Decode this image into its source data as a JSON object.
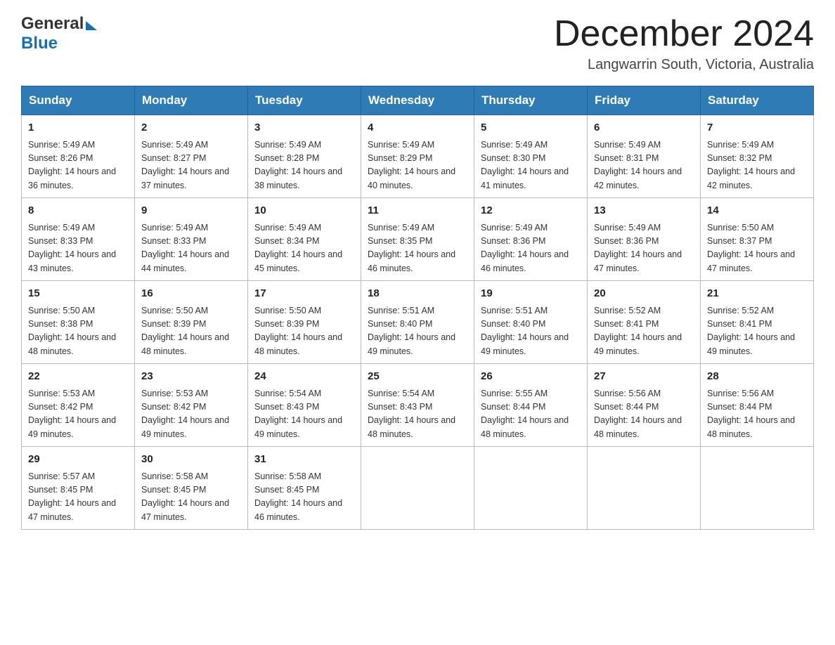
{
  "header": {
    "logo_general": "General",
    "logo_blue": "Blue",
    "month_title": "December 2024",
    "location": "Langwarrin South, Victoria, Australia"
  },
  "calendar": {
    "days_of_week": [
      "Sunday",
      "Monday",
      "Tuesday",
      "Wednesday",
      "Thursday",
      "Friday",
      "Saturday"
    ],
    "weeks": [
      [
        {
          "day": "1",
          "sunrise": "5:49 AM",
          "sunset": "8:26 PM",
          "daylight": "14 hours and 36 minutes."
        },
        {
          "day": "2",
          "sunrise": "5:49 AM",
          "sunset": "8:27 PM",
          "daylight": "14 hours and 37 minutes."
        },
        {
          "day": "3",
          "sunrise": "5:49 AM",
          "sunset": "8:28 PM",
          "daylight": "14 hours and 38 minutes."
        },
        {
          "day": "4",
          "sunrise": "5:49 AM",
          "sunset": "8:29 PM",
          "daylight": "14 hours and 40 minutes."
        },
        {
          "day": "5",
          "sunrise": "5:49 AM",
          "sunset": "8:30 PM",
          "daylight": "14 hours and 41 minutes."
        },
        {
          "day": "6",
          "sunrise": "5:49 AM",
          "sunset": "8:31 PM",
          "daylight": "14 hours and 42 minutes."
        },
        {
          "day": "7",
          "sunrise": "5:49 AM",
          "sunset": "8:32 PM",
          "daylight": "14 hours and 42 minutes."
        }
      ],
      [
        {
          "day": "8",
          "sunrise": "5:49 AM",
          "sunset": "8:33 PM",
          "daylight": "14 hours and 43 minutes."
        },
        {
          "day": "9",
          "sunrise": "5:49 AM",
          "sunset": "8:33 PM",
          "daylight": "14 hours and 44 minutes."
        },
        {
          "day": "10",
          "sunrise": "5:49 AM",
          "sunset": "8:34 PM",
          "daylight": "14 hours and 45 minutes."
        },
        {
          "day": "11",
          "sunrise": "5:49 AM",
          "sunset": "8:35 PM",
          "daylight": "14 hours and 46 minutes."
        },
        {
          "day": "12",
          "sunrise": "5:49 AM",
          "sunset": "8:36 PM",
          "daylight": "14 hours and 46 minutes."
        },
        {
          "day": "13",
          "sunrise": "5:49 AM",
          "sunset": "8:36 PM",
          "daylight": "14 hours and 47 minutes."
        },
        {
          "day": "14",
          "sunrise": "5:50 AM",
          "sunset": "8:37 PM",
          "daylight": "14 hours and 47 minutes."
        }
      ],
      [
        {
          "day": "15",
          "sunrise": "5:50 AM",
          "sunset": "8:38 PM",
          "daylight": "14 hours and 48 minutes."
        },
        {
          "day": "16",
          "sunrise": "5:50 AM",
          "sunset": "8:39 PM",
          "daylight": "14 hours and 48 minutes."
        },
        {
          "day": "17",
          "sunrise": "5:50 AM",
          "sunset": "8:39 PM",
          "daylight": "14 hours and 48 minutes."
        },
        {
          "day": "18",
          "sunrise": "5:51 AM",
          "sunset": "8:40 PM",
          "daylight": "14 hours and 49 minutes."
        },
        {
          "day": "19",
          "sunrise": "5:51 AM",
          "sunset": "8:40 PM",
          "daylight": "14 hours and 49 minutes."
        },
        {
          "day": "20",
          "sunrise": "5:52 AM",
          "sunset": "8:41 PM",
          "daylight": "14 hours and 49 minutes."
        },
        {
          "day": "21",
          "sunrise": "5:52 AM",
          "sunset": "8:41 PM",
          "daylight": "14 hours and 49 minutes."
        }
      ],
      [
        {
          "day": "22",
          "sunrise": "5:53 AM",
          "sunset": "8:42 PM",
          "daylight": "14 hours and 49 minutes."
        },
        {
          "day": "23",
          "sunrise": "5:53 AM",
          "sunset": "8:42 PM",
          "daylight": "14 hours and 49 minutes."
        },
        {
          "day": "24",
          "sunrise": "5:54 AM",
          "sunset": "8:43 PM",
          "daylight": "14 hours and 49 minutes."
        },
        {
          "day": "25",
          "sunrise": "5:54 AM",
          "sunset": "8:43 PM",
          "daylight": "14 hours and 48 minutes."
        },
        {
          "day": "26",
          "sunrise": "5:55 AM",
          "sunset": "8:44 PM",
          "daylight": "14 hours and 48 minutes."
        },
        {
          "day": "27",
          "sunrise": "5:56 AM",
          "sunset": "8:44 PM",
          "daylight": "14 hours and 48 minutes."
        },
        {
          "day": "28",
          "sunrise": "5:56 AM",
          "sunset": "8:44 PM",
          "daylight": "14 hours and 48 minutes."
        }
      ],
      [
        {
          "day": "29",
          "sunrise": "5:57 AM",
          "sunset": "8:45 PM",
          "daylight": "14 hours and 47 minutes."
        },
        {
          "day": "30",
          "sunrise": "5:58 AM",
          "sunset": "8:45 PM",
          "daylight": "14 hours and 47 minutes."
        },
        {
          "day": "31",
          "sunrise": "5:58 AM",
          "sunset": "8:45 PM",
          "daylight": "14 hours and 46 minutes."
        },
        null,
        null,
        null,
        null
      ]
    ]
  }
}
